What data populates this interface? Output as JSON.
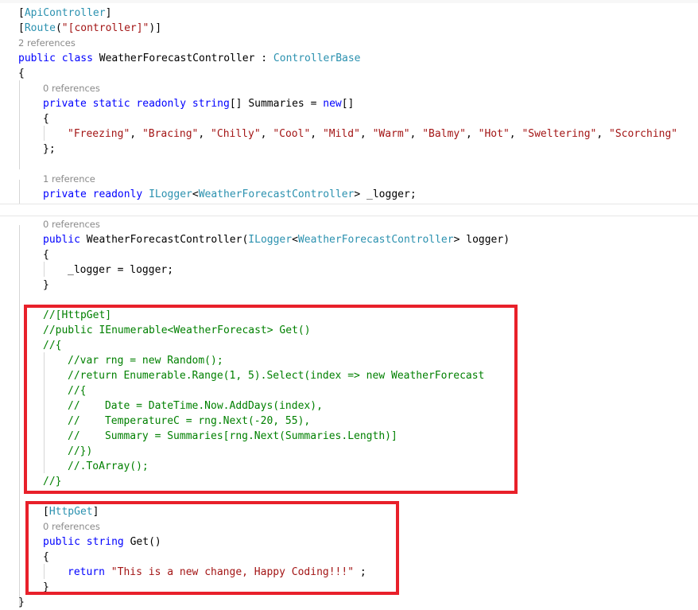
{
  "editor": {
    "lines": [
      {
        "lens": false,
        "indent": 0,
        "tokens": [
          [
            "p",
            "["
          ],
          [
            "t",
            "ApiController"
          ],
          [
            "p",
            "]"
          ]
        ]
      },
      {
        "lens": false,
        "indent": 0,
        "tokens": [
          [
            "p",
            "["
          ],
          [
            "t",
            "Route"
          ],
          [
            "p",
            "("
          ],
          [
            "s",
            "\"[controller]\""
          ],
          [
            "p",
            ")]"
          ]
        ]
      },
      {
        "lens": true,
        "indent": 0,
        "text": "2 references"
      },
      {
        "lens": false,
        "indent": 0,
        "tokens": [
          [
            "k",
            "public"
          ],
          [
            "p",
            " "
          ],
          [
            "k",
            "class"
          ],
          [
            "p",
            " WeatherForecastController : "
          ],
          [
            "t",
            "ControllerBase"
          ]
        ]
      },
      {
        "lens": false,
        "indent": 0,
        "tokens": [
          [
            "p",
            "{"
          ]
        ]
      },
      {
        "lens": true,
        "indent": 1,
        "text": "0 references"
      },
      {
        "lens": false,
        "indent": 1,
        "tokens": [
          [
            "k",
            "private"
          ],
          [
            "p",
            " "
          ],
          [
            "k",
            "static"
          ],
          [
            "p",
            " "
          ],
          [
            "k",
            "readonly"
          ],
          [
            "p",
            " "
          ],
          [
            "k",
            "string"
          ],
          [
            "p",
            "[] Summaries = "
          ],
          [
            "k",
            "new"
          ],
          [
            "p",
            "[]"
          ]
        ]
      },
      {
        "lens": false,
        "indent": 1,
        "tokens": [
          [
            "p",
            "{"
          ]
        ]
      },
      {
        "lens": false,
        "indent": 2,
        "tokens": [
          [
            "s",
            "\"Freezing\""
          ],
          [
            "p",
            ", "
          ],
          [
            "s",
            "\"Bracing\""
          ],
          [
            "p",
            ", "
          ],
          [
            "s",
            "\"Chilly\""
          ],
          [
            "p",
            ", "
          ],
          [
            "s",
            "\"Cool\""
          ],
          [
            "p",
            ", "
          ],
          [
            "s",
            "\"Mild\""
          ],
          [
            "p",
            ", "
          ],
          [
            "s",
            "\"Warm\""
          ],
          [
            "p",
            ", "
          ],
          [
            "s",
            "\"Balmy\""
          ],
          [
            "p",
            ", "
          ],
          [
            "s",
            "\"Hot\""
          ],
          [
            "p",
            ", "
          ],
          [
            "s",
            "\"Sweltering\""
          ],
          [
            "p",
            ", "
          ],
          [
            "s",
            "\"Scorching\""
          ]
        ]
      },
      {
        "lens": false,
        "indent": 1,
        "tokens": [
          [
            "p",
            "};"
          ]
        ]
      },
      {
        "lens": false,
        "indent": 0,
        "tokens": []
      },
      {
        "lens": true,
        "indent": 1,
        "text": "1 reference"
      },
      {
        "lens": false,
        "indent": 1,
        "tokens": [
          [
            "k",
            "private"
          ],
          [
            "p",
            " "
          ],
          [
            "k",
            "readonly"
          ],
          [
            "p",
            " "
          ],
          [
            "t",
            "ILogger"
          ],
          [
            "p",
            "<"
          ],
          [
            "t",
            "WeatherForecastController"
          ],
          [
            "p",
            "> _logger;"
          ]
        ]
      },
      {
        "lens": false,
        "indent": 0,
        "tokens": []
      },
      {
        "lens": true,
        "indent": 1,
        "text": "0 references"
      },
      {
        "lens": false,
        "indent": 1,
        "tokens": [
          [
            "k",
            "public"
          ],
          [
            "p",
            " WeatherForecastController("
          ],
          [
            "t",
            "ILogger"
          ],
          [
            "p",
            "<"
          ],
          [
            "t",
            "WeatherForecastController"
          ],
          [
            "p",
            "> logger)"
          ]
        ]
      },
      {
        "lens": false,
        "indent": 1,
        "tokens": [
          [
            "p",
            "{"
          ]
        ]
      },
      {
        "lens": false,
        "indent": 2,
        "tokens": [
          [
            "p",
            "_logger = logger;"
          ]
        ]
      },
      {
        "lens": false,
        "indent": 1,
        "tokens": [
          [
            "p",
            "}"
          ]
        ]
      },
      {
        "lens": false,
        "indent": 0,
        "tokens": []
      },
      {
        "lens": false,
        "indent": 1,
        "tokens": [
          [
            "c",
            "//[HttpGet]"
          ]
        ]
      },
      {
        "lens": false,
        "indent": 1,
        "tokens": [
          [
            "c",
            "//public IEnumerable<WeatherForecast> Get()"
          ]
        ]
      },
      {
        "lens": false,
        "indent": 1,
        "tokens": [
          [
            "c",
            "//{"
          ]
        ]
      },
      {
        "lens": false,
        "indent": 2,
        "tokens": [
          [
            "c",
            "//var rng = new Random();"
          ]
        ]
      },
      {
        "lens": false,
        "indent": 2,
        "tokens": [
          [
            "c",
            "//return Enumerable.Range(1, 5).Select(index => new WeatherForecast"
          ]
        ]
      },
      {
        "lens": false,
        "indent": 2,
        "tokens": [
          [
            "c",
            "//{"
          ]
        ]
      },
      {
        "lens": false,
        "indent": 2,
        "tokens": [
          [
            "c",
            "//    Date = DateTime.Now.AddDays(index),"
          ]
        ]
      },
      {
        "lens": false,
        "indent": 2,
        "tokens": [
          [
            "c",
            "//    TemperatureC = rng.Next(-20, 55),"
          ]
        ]
      },
      {
        "lens": false,
        "indent": 2,
        "tokens": [
          [
            "c",
            "//    Summary = Summaries[rng.Next(Summaries.Length)]"
          ]
        ]
      },
      {
        "lens": false,
        "indent": 2,
        "tokens": [
          [
            "c",
            "//})"
          ]
        ]
      },
      {
        "lens": false,
        "indent": 2,
        "tokens": [
          [
            "c",
            "//.ToArray();"
          ]
        ]
      },
      {
        "lens": false,
        "indent": 1,
        "tokens": [
          [
            "c",
            "//}"
          ]
        ]
      },
      {
        "lens": false,
        "indent": 0,
        "tokens": []
      },
      {
        "lens": false,
        "indent": 1,
        "tokens": [
          [
            "p",
            "["
          ],
          [
            "t",
            "HttpGet"
          ],
          [
            "p",
            "]"
          ]
        ]
      },
      {
        "lens": true,
        "indent": 1,
        "text": "0 references"
      },
      {
        "lens": false,
        "indent": 1,
        "tokens": [
          [
            "k",
            "public"
          ],
          [
            "p",
            " "
          ],
          [
            "k",
            "string"
          ],
          [
            "p",
            " Get()"
          ]
        ]
      },
      {
        "lens": false,
        "indent": 1,
        "tokens": [
          [
            "p",
            "{"
          ]
        ]
      },
      {
        "lens": false,
        "indent": 2,
        "tokens": [
          [
            "k",
            "return"
          ],
          [
            "p",
            " "
          ],
          [
            "s",
            "\"This is a new change, Happy Coding!!!\""
          ],
          [
            "p",
            " ;"
          ]
        ]
      },
      {
        "lens": false,
        "indent": 1,
        "tokens": [
          [
            "p",
            "}"
          ]
        ]
      },
      {
        "lens": false,
        "indent": 0,
        "tokens": [
          [
            "p",
            "}"
          ]
        ]
      }
    ]
  },
  "colors": {
    "keyword": "#0000ff",
    "type": "#2b91af",
    "string": "#a31515",
    "comment": "#008000",
    "codelens": "#8a8a8a",
    "highlight_border": "#e8202a"
  }
}
